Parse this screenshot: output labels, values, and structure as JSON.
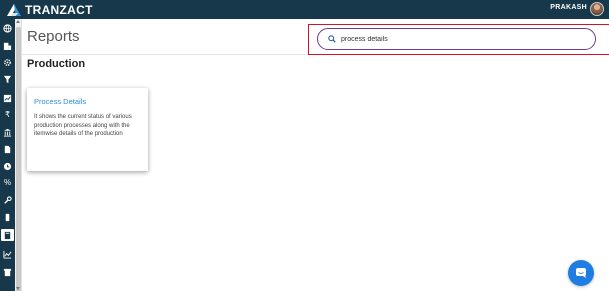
{
  "brand": {
    "name": "TRANZACT"
  },
  "header": {
    "user_name": "PRAKASH"
  },
  "page": {
    "title": "Reports",
    "section_title": "Production"
  },
  "search": {
    "value": "process details"
  },
  "cards": [
    {
      "title": "Process Details",
      "description": "It shows the current status of various production processes along with the itemwise details of the production"
    }
  ],
  "sidebar": {
    "icons": [
      "globe-icon",
      "building-icon",
      "gear-icon",
      "funnel-icon",
      "report-icon",
      "rupee-icon",
      "bank-icon",
      "document-icon",
      "clock-icon",
      "percent-icon",
      "wrench-icon",
      "mobile-icon",
      "book-icon",
      "chart-icon",
      "box-icon"
    ],
    "active_index": 12
  },
  "colors": {
    "header_bg": "#17384a",
    "accent": "#2c8fd6",
    "highlight": "#d0142c",
    "search_border": "#6b3b8c",
    "chat": "#1f7de2"
  }
}
